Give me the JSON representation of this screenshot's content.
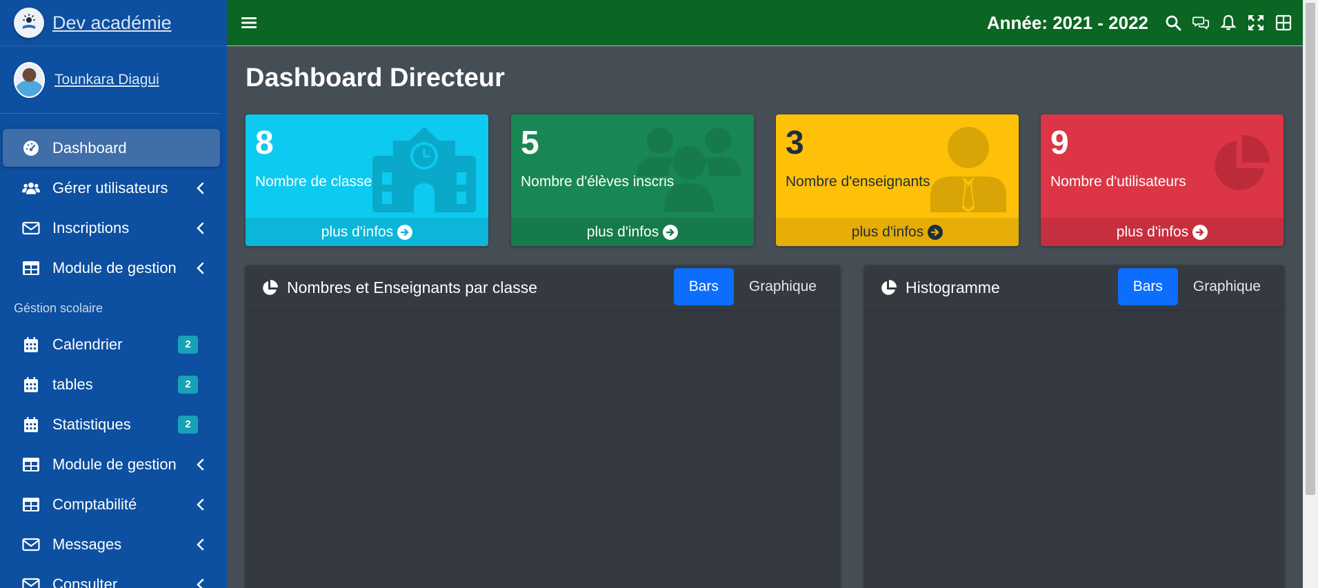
{
  "brand": {
    "name": "Dev académie"
  },
  "user": {
    "name": "Tounkara Diagui"
  },
  "nav": {
    "items": [
      {
        "label": "Dashboard"
      },
      {
        "label": "Gérer utilisateurs"
      },
      {
        "label": "Inscriptions"
      },
      {
        "label": "Module de gestion"
      }
    ],
    "section_header": "Géstion scolaire",
    "section_items": [
      {
        "label": "Calendrier",
        "badge": "2"
      },
      {
        "label": "tables",
        "badge": "2"
      },
      {
        "label": "Statistiques",
        "badge": "2"
      },
      {
        "label": "Module de gestion"
      },
      {
        "label": "Comptabilité"
      },
      {
        "label": "Messages"
      },
      {
        "label": "Consulter"
      }
    ]
  },
  "topbar": {
    "year": "Année: 2021 - 2022"
  },
  "page": {
    "title": "Dashboard Directeur"
  },
  "stats": [
    {
      "value": "8",
      "label": "Nombre de classes",
      "footer": "plus d'infos"
    },
    {
      "value": "5",
      "label": "Nombre d'élèves inscris",
      "footer": "plus d'infos"
    },
    {
      "value": "3",
      "label": "Nombre d'enseignants",
      "footer": "plus d'infos"
    },
    {
      "value": "9",
      "label": "Nombre d'utilisateurs",
      "footer": "plus d'infos"
    }
  ],
  "cards": [
    {
      "title": "Nombres et Enseignants par classe",
      "tab_bars": "Bars",
      "tab_graph": "Graphique"
    },
    {
      "title": "Histogramme",
      "tab_bars": "Bars",
      "tab_graph": "Graphique"
    }
  ],
  "colors": {
    "sidebar": "#0d4fa0",
    "topbar": "#0b6623",
    "info": "#0dcaf0",
    "success": "#198754",
    "warning": "#ffc107",
    "danger": "#dc3545",
    "primary": "#0d6efd"
  }
}
